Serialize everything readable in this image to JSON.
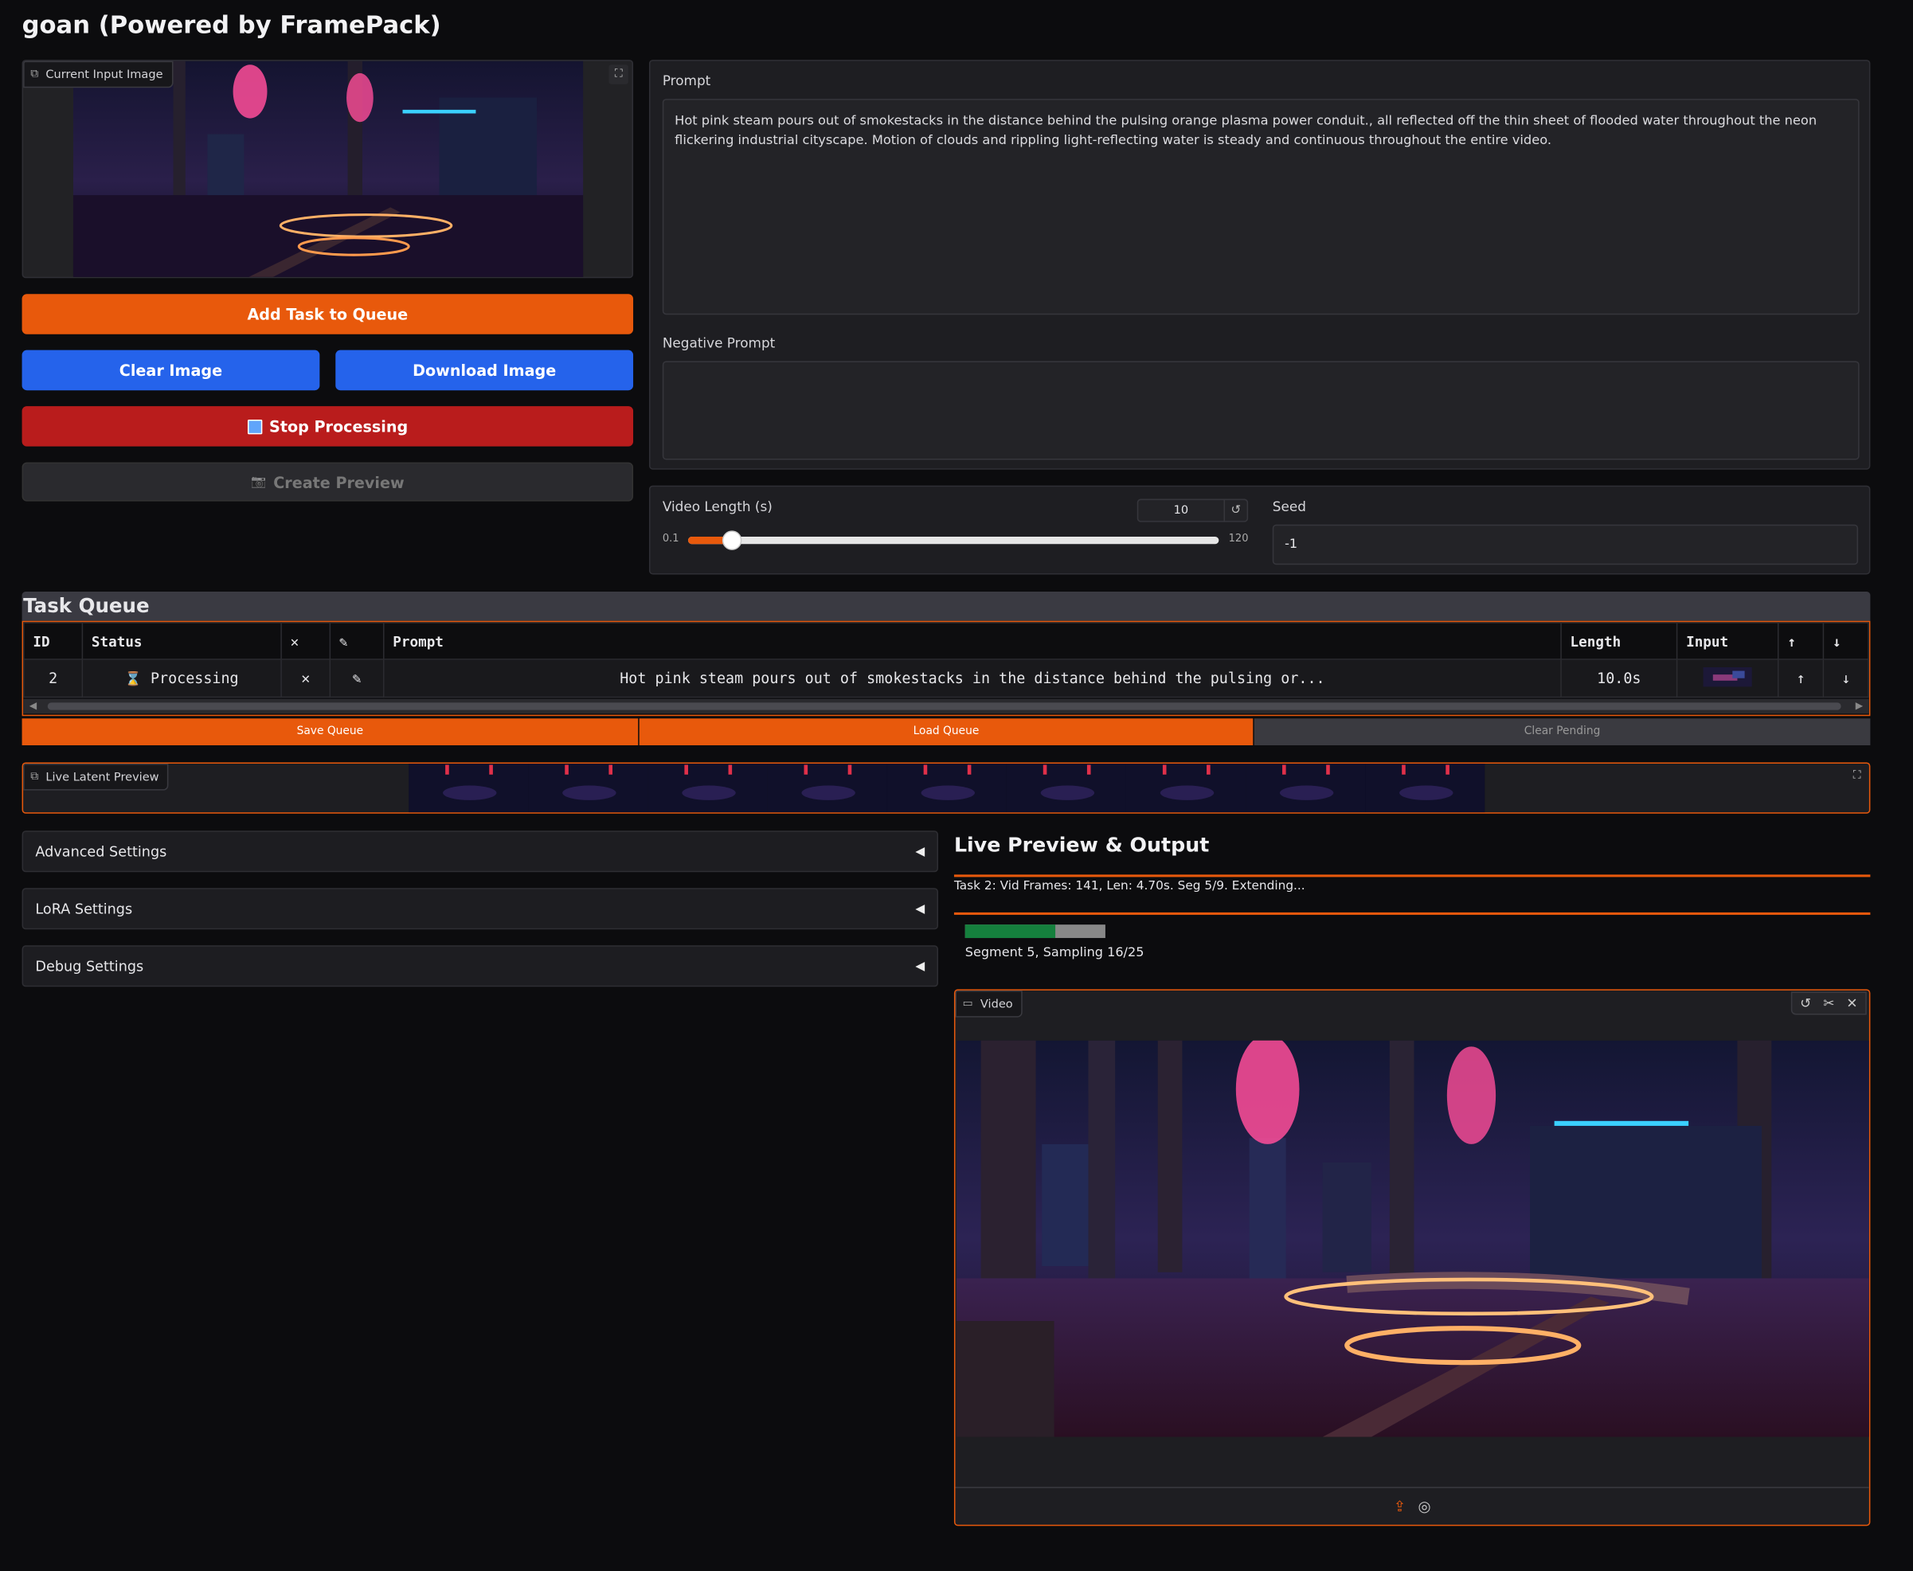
{
  "app": {
    "title": "goan (Powered by FramePack)"
  },
  "input_image": {
    "label": "Current Input Image"
  },
  "buttons": {
    "add_task": "Add Task to Queue",
    "clear_image": "Clear Image",
    "download_image": "Download Image",
    "stop_processing": "Stop Processing",
    "create_preview": "Create Preview"
  },
  "prompt": {
    "label": "Prompt",
    "value": "Hot pink steam pours out of smokestacks in the distance behind the pulsing orange plasma power conduit., all reflected off the thin sheet of flooded water throughout the neon flickering industrial cityscape. Motion of clouds and rippling light-reflecting water is steady and continuous throughout the entire video."
  },
  "negative_prompt": {
    "label": "Negative Prompt",
    "value": ""
  },
  "video_length": {
    "label": "Video Length (s)",
    "value": "10",
    "min": "0.1",
    "max": "120",
    "fraction": 0.083
  },
  "seed": {
    "label": "Seed",
    "value": "-1"
  },
  "task_queue": {
    "title": "Task Queue",
    "headers": {
      "id": "ID",
      "status": "Status",
      "remove": "✕",
      "edit": "✎",
      "prompt": "Prompt",
      "length": "Length",
      "input": "Input",
      "up": "↑",
      "down": "↓"
    },
    "rows": [
      {
        "id": "2",
        "status_icon": "⌛",
        "status": "Processing",
        "remove": "✕",
        "edit": "✎",
        "prompt": "Hot pink steam pours out of smokestacks in the distance behind the pulsing or...",
        "length": "10.0s",
        "up": "↑",
        "down": "↓"
      }
    ],
    "save": "Save Queue",
    "load": "Load Queue",
    "clear": "Clear Pending"
  },
  "live_latent": {
    "label": "Live Latent Preview"
  },
  "settings": {
    "advanced": "Advanced Settings",
    "lora": "LoRA Settings",
    "debug": "Debug Settings"
  },
  "output": {
    "title": "Live Preview & Output",
    "status": "Task 2: Vid Frames: 141, Len: 4.70s. Seg 5/9. Extending...",
    "progress_fraction": 0.64,
    "progress_label": "Segment 5, Sampling 16/25",
    "video_label": "Video"
  },
  "colors": {
    "accent": "#e8590c",
    "blue": "#2563eb",
    "red": "#b91c1c",
    "progress": "#15803d"
  },
  "icons": {
    "image": "⧉",
    "fullscreen": "⛶",
    "stop": "■",
    "camera": "📷",
    "reset": "↺",
    "tri": "◀",
    "video": "▭",
    "undo": "↺",
    "cut": "✂",
    "close": "✕",
    "upload": "⇪",
    "webcam": "◎"
  }
}
